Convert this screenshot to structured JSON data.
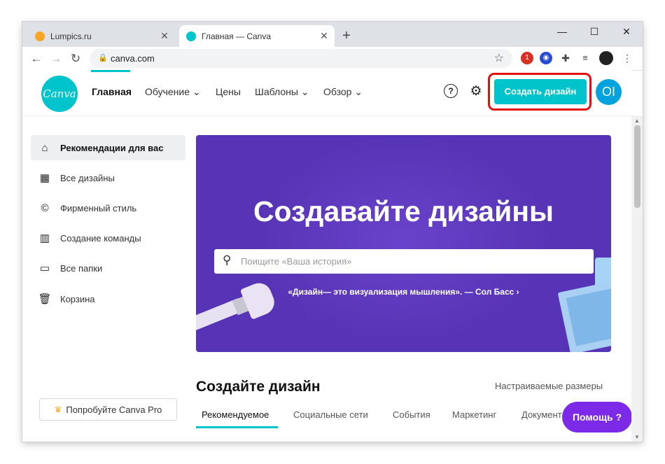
{
  "browser": {
    "tabs": [
      {
        "title": "Lumpics.ru",
        "favicon_color": "#f5a623"
      },
      {
        "title": "Главная — Canva",
        "favicon_color": "#00c4cc"
      }
    ],
    "new_tab_glyph": "+",
    "window_controls": {
      "minimize": "—",
      "maximize": "☐",
      "close": "✕"
    },
    "url": "canva.com",
    "extension_badge": "1"
  },
  "canva": {
    "logo_text": "Canva",
    "nav": [
      {
        "label": "Главная"
      },
      {
        "label": "Обучение",
        "dropdown": true
      },
      {
        "label": "Цены"
      },
      {
        "label": "Шаблоны",
        "dropdown": true
      },
      {
        "label": "Обзор",
        "dropdown": true
      }
    ],
    "create_button": "Создать дизайн",
    "avatar_initials": "OI",
    "brand_color": "#00c4cc",
    "highlight_color": "#e30f0f"
  },
  "sidebar": {
    "items": [
      {
        "label": "Рекомендации для вас",
        "icon": "home-icon",
        "glyph": "⌂",
        "active": true
      },
      {
        "label": "Все дизайны",
        "icon": "grid-icon",
        "glyph": "▦"
      },
      {
        "label": "Фирменный стиль",
        "icon": "brand-kit-icon",
        "glyph": "©"
      },
      {
        "label": "Создание команды",
        "icon": "building-icon",
        "glyph": "▥"
      },
      {
        "label": "Все папки",
        "icon": "folder-icon",
        "glyph": "▭"
      },
      {
        "label": "Корзина",
        "icon": "trash-icon",
        "glyph": "🗑"
      }
    ],
    "pro_button": "Попробуйте Canva Pro"
  },
  "hero": {
    "title": "Создавайте дизайны",
    "search_placeholder": "Поищите «Ваша история»",
    "quote": "«Дизайн— это визуализация мышления». — Сол Басс ›",
    "background_color": "#5733b5"
  },
  "create_section": {
    "title": "Создайте дизайн",
    "custom_sizes_link": "Настраиваемые размеры",
    "categories": [
      {
        "label": "Рекомендуемое",
        "active": true
      },
      {
        "label": "Социальные сети"
      },
      {
        "label": "События"
      },
      {
        "label": "Маркетинг"
      },
      {
        "label": "Документ"
      }
    ]
  },
  "help_button": "Помощь ?",
  "help_button_color": "#7d2ae8"
}
